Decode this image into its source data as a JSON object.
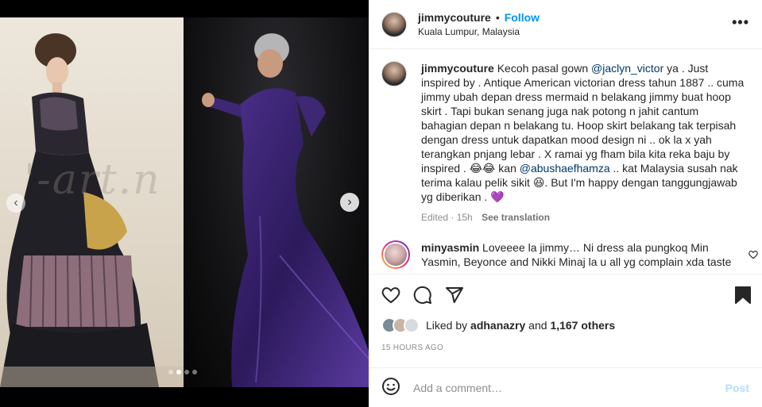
{
  "header": {
    "username": "jimmycouture",
    "bullet": "•",
    "follow_label": "Follow",
    "location": "Kuala Lumpur, Malaysia",
    "more_label": "•••"
  },
  "media": {
    "watermark": "'-art.n",
    "prev_icon": "chevron-left-icon",
    "next_icon": "chevron-right-icon",
    "slide_count": 4,
    "active_slide": 2
  },
  "caption": {
    "username": "jimmycouture",
    "text_1": " Kecoh pasal gown ",
    "mention_1": "@jaclyn_victor",
    "text_2": " ya . Just inspired by . Antique American victorian dress tahun 1887 .. cuma jimmy ubah depan dress mermaid n belakang jimmy buat hoop skirt . Tapi bukan senang juga nak potong n jahit cantum bahagian depan n belakang tu. Hoop skirt belakang tak terpisah dengan dress untuk dapatkan mood design ni .. ok la x yah terangkan pnjang lebar . X ramai yg fham bila kita reka baju by inspired . 😂😂 kan ",
    "mention_2": "@abushaefhamza",
    "text_3": " .. kat Malaysia susah nak terima kalau pelik sikit 😆. But I'm happy dengan tanggungjawab yg diberikan . 💜",
    "edited": "Edited · 15h",
    "see_translation": "See translation"
  },
  "comment": {
    "username": "minyasmin",
    "text": " Loveeee la jimmy… Ni dress ala pungkoq Min Yasmin, Beyonce and Nikki Minaj la u all yg complain xda taste"
  },
  "actions": {
    "like_icon": "heart-icon",
    "comment_icon": "comment-icon",
    "share_icon": "share-icon",
    "save_icon": "bookmark-icon"
  },
  "likes": {
    "prefix": "Liked by ",
    "user": "adhanazry",
    "middle": " and ",
    "count": "1,167 others"
  },
  "time_ago": "15 HOURS AGO",
  "comment_bar": {
    "emoji_icon": "smiley-icon",
    "placeholder": "Add a comment…",
    "post_label": "Post"
  },
  "colors": {
    "accent": "#0095f6",
    "mention": "#00376b",
    "post_disabled": "#b2dffc",
    "muted": "#8e8e8e"
  }
}
